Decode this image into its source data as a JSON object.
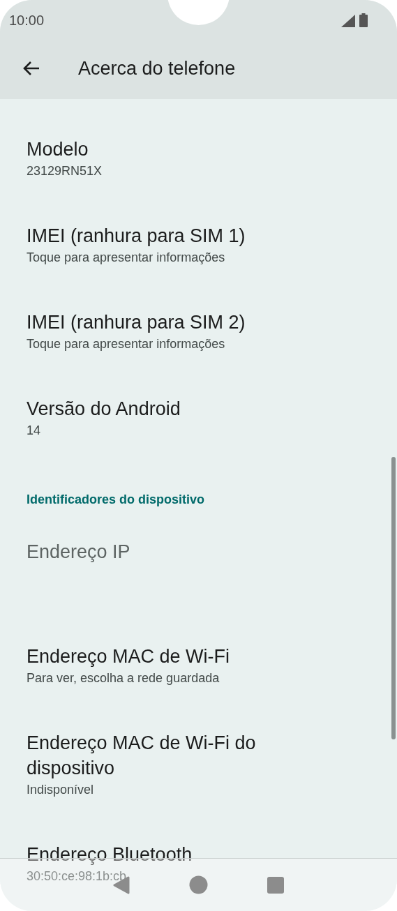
{
  "status_bar": {
    "time": "10:00"
  },
  "app_bar": {
    "title": "Acerca do telefone"
  },
  "items": [
    {
      "kind": "preference",
      "title": "Modelo",
      "summary": "23129RN51X",
      "disabled": false
    },
    {
      "kind": "preference",
      "title": "IMEI (ranhura para SIM 1)",
      "summary": "Toque para apresentar informações",
      "disabled": false
    },
    {
      "kind": "preference",
      "title": "IMEI (ranhura para SIM 2)",
      "summary": "Toque para apresentar informações",
      "disabled": false
    },
    {
      "kind": "preference",
      "title": "Versão do Android",
      "summary": "14",
      "disabled": false
    },
    {
      "kind": "category",
      "title": "Identificadores do dispositivo"
    },
    {
      "kind": "preference",
      "title": "Endereço IP",
      "disabled": true
    },
    {
      "kind": "preference",
      "title": "Endereço MAC de Wi-Fi",
      "summary": "Para ver, escolha a rede guardada",
      "disabled": false
    },
    {
      "kind": "preference",
      "title": "Endereço MAC de Wi-Fi do dispositivo",
      "summary": "Indisponível",
      "disabled": false
    },
    {
      "kind": "preference",
      "title": "Endereço Bluetooth",
      "summary": "30:50:ce:98:1b:cb",
      "disabled": false
    }
  ]
}
